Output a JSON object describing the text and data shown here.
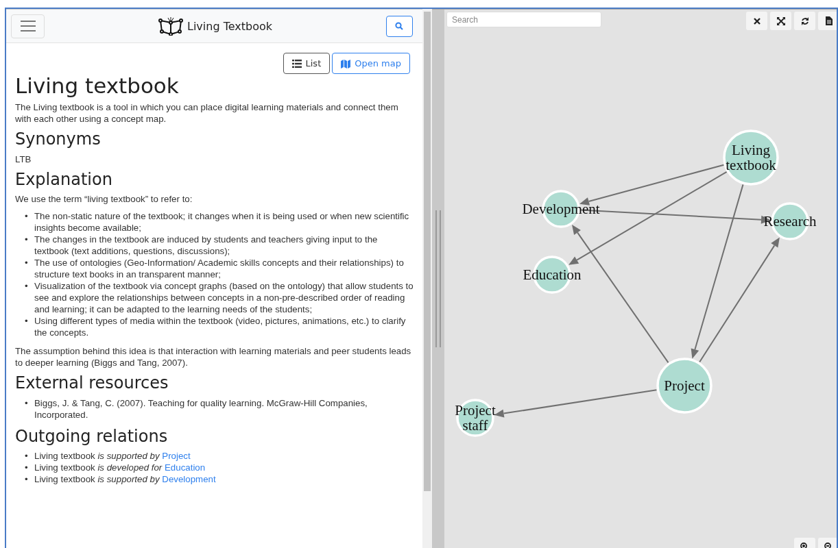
{
  "navbar": {
    "brand": "Living Textbook"
  },
  "toolbar": {
    "buttons": [
      {
        "label": "List",
        "kind": "list"
      },
      {
        "label": "Open map",
        "kind": "map"
      }
    ]
  },
  "concept": {
    "title": "Living textbook",
    "sections": [
      {
        "blocks": [
          {
            "kind": "paragraph",
            "text": "The Living textbook is a tool in which you can place digital learning materials and connect them with each other using a concept map."
          }
        ]
      },
      {
        "heading": "Synonyms",
        "blocks": [
          {
            "kind": "paragraph",
            "text": "LTB"
          }
        ]
      },
      {
        "heading": "Explanation",
        "blocks": [
          {
            "kind": "paragraph",
            "text": "We use the term “living textbook” to refer to:"
          },
          {
            "kind": "list",
            "marker": "•",
            "items": [
              "The non-static nature of the textbook; it changes when it is being used or when new scientific insights become available;",
              "The changes in the textbook are induced by students and teachers giving input to the textbook (text additions, questions, discussions);",
              "The use of ontologies (Geo-Information/ Academic skills concepts and their relationships) to structure text books in an transparent manner;",
              "Visualization of the textbook via concept graphs (based on the ontology) that allow students to see and explore the relationships between concepts in a non-pre-described order of reading and learning; it can be adapted to the learning needs of the students;",
              "Using different types of media within the textbook (video, pictures, animations, etc.) to clarify the concepts."
            ]
          },
          {
            "kind": "paragraph",
            "text": "The assumption behind this idea is that interaction with learning materials and peer students leads to deeper learning (Biggs and Tang, 2007)."
          }
        ]
      },
      {
        "heading": "External resources",
        "blocks": [
          {
            "kind": "list",
            "marker": "•",
            "items": [
              "Biggs, J. & Tang, C. (2007). Teaching for quality learning. McGraw-Hill Companies, Incorporated."
            ]
          }
        ]
      },
      {
        "heading": "Outgoing relations",
        "blocks": [
          {
            "kind": "relations",
            "marker": "•",
            "items": [
              {
                "subject": "Living textbook",
                "relation": "is supported by",
                "target": "Project"
              },
              {
                "subject": "Living textbook",
                "relation": "is developed for",
                "target": "Education"
              },
              {
                "subject": "Living textbook",
                "relation": "is supported by",
                "target": "Development"
              }
            ]
          }
        ]
      }
    ]
  },
  "graph": {
    "search": {
      "placeholder": "Search"
    },
    "tools": [
      {
        "kind": "close"
      },
      {
        "kind": "fullscreen"
      },
      {
        "kind": "refresh"
      },
      {
        "kind": "export"
      }
    ],
    "zoom": [
      {
        "kind": "zoom-in"
      },
      {
        "kind": "zoom-out"
      }
    ],
    "nodes": [
      {
        "label": "Living textbook"
      },
      {
        "label": "Development"
      },
      {
        "label": "Research"
      },
      {
        "label": "Education"
      },
      {
        "label": "Project"
      },
      {
        "label": "Project staff"
      }
    ]
  }
}
